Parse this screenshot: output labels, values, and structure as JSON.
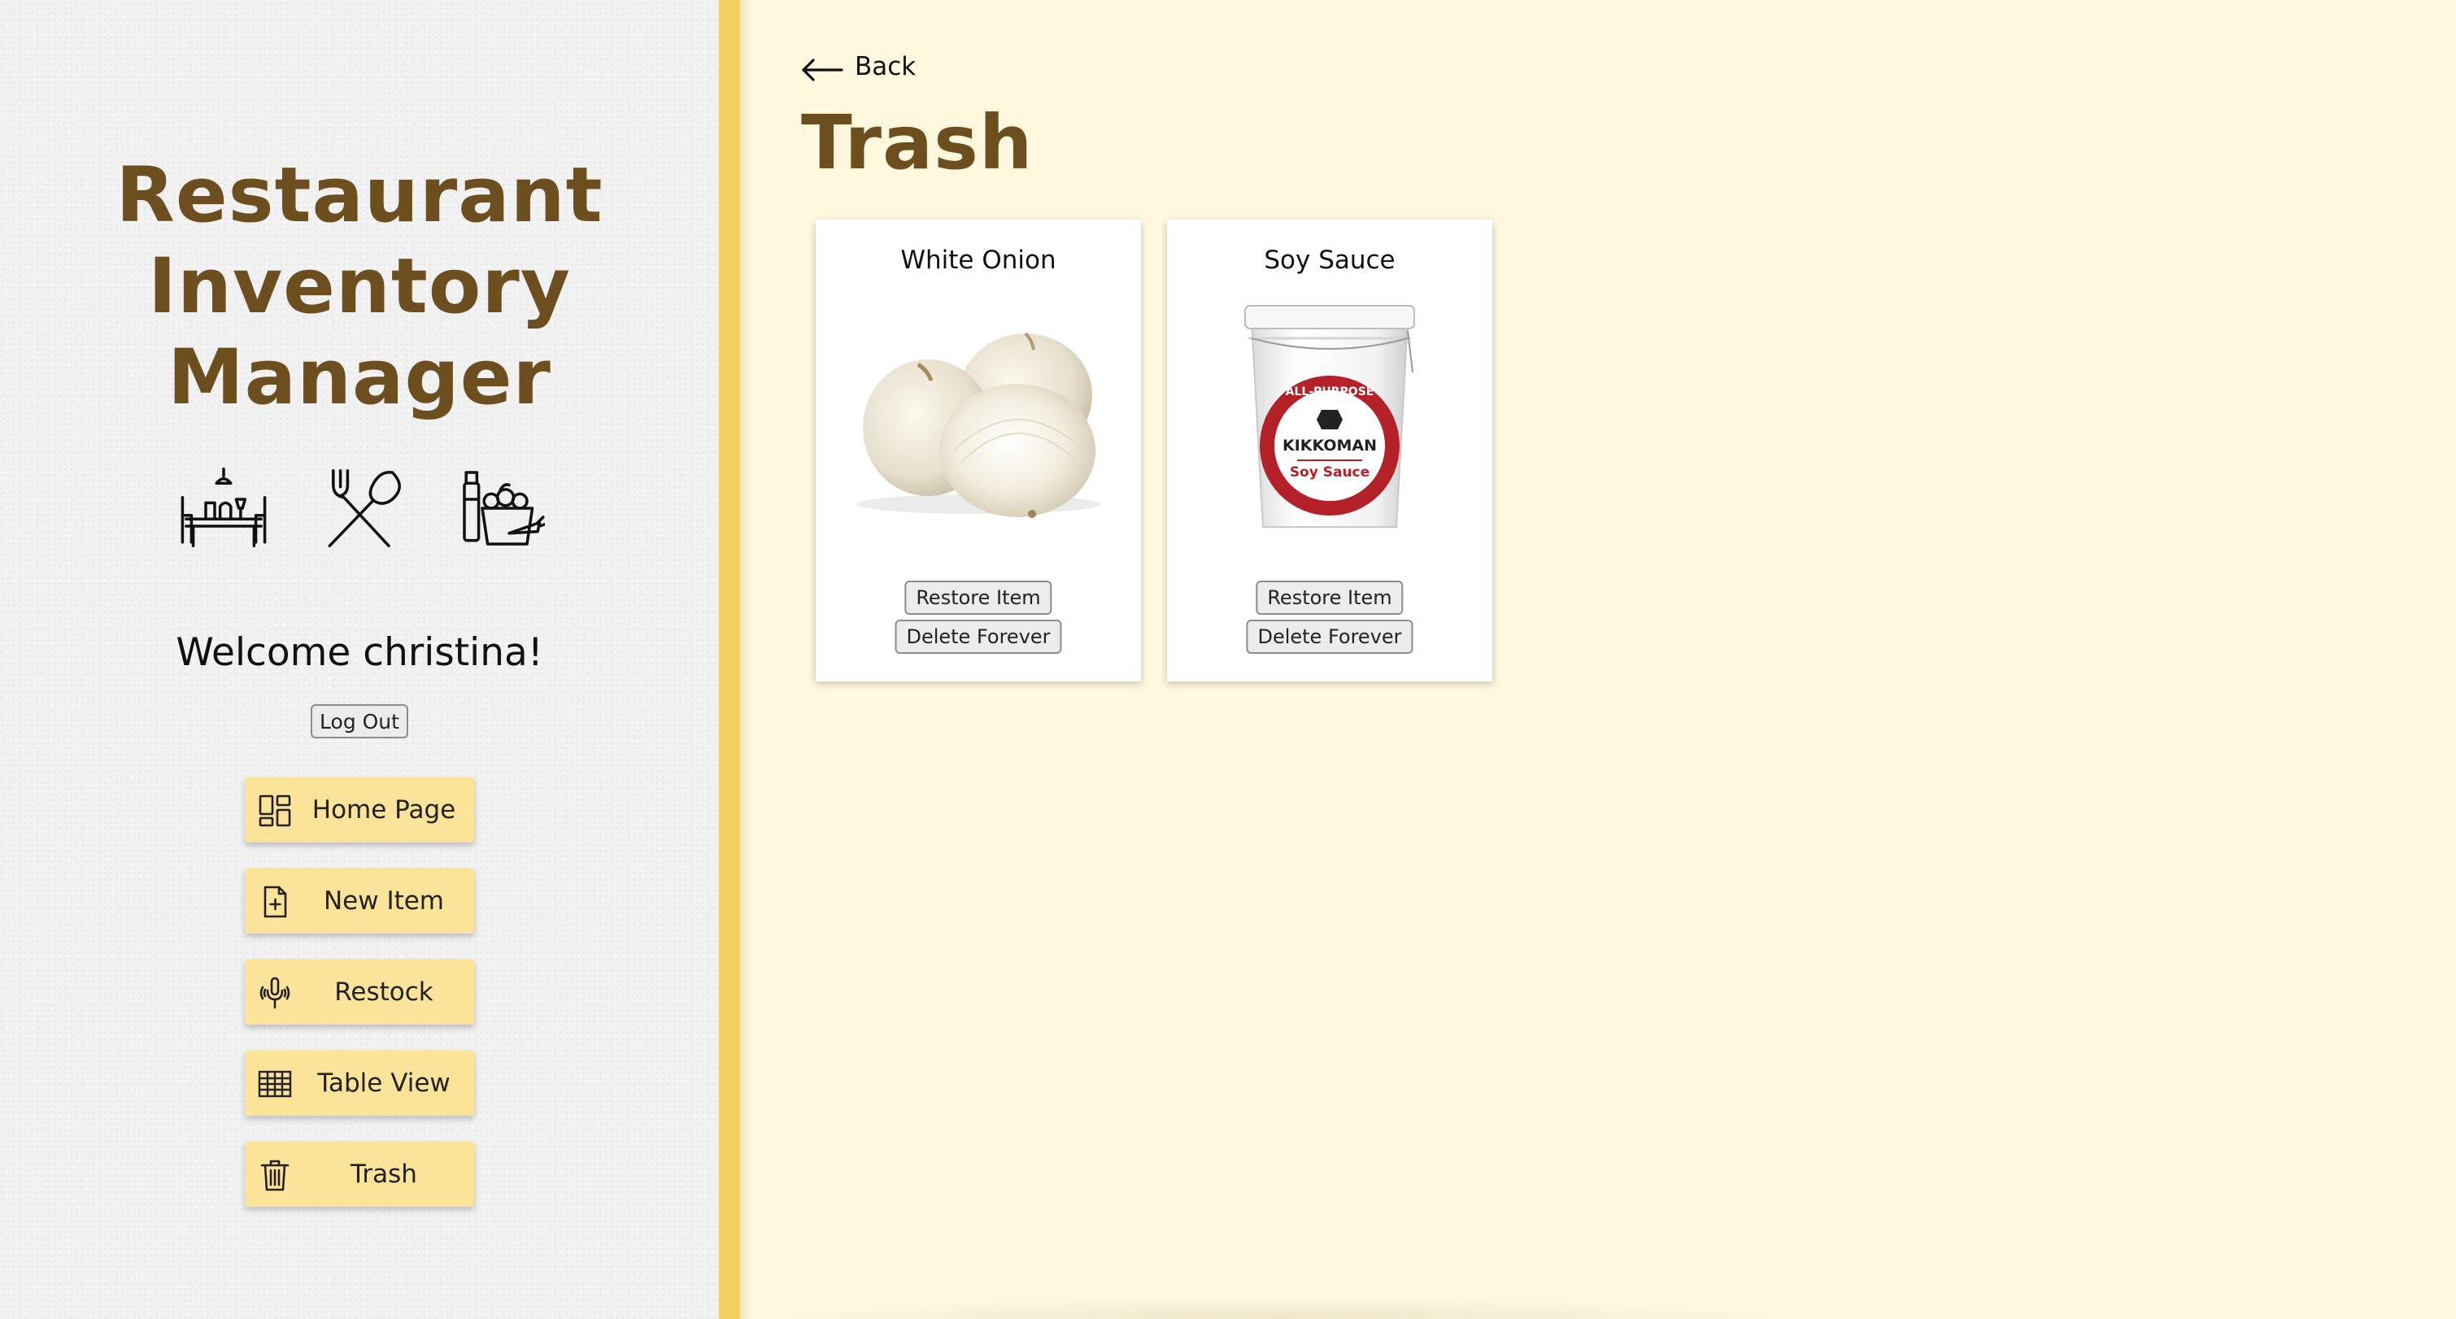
{
  "sidebar": {
    "app_title_lines": [
      "Restaurant",
      "Inventory",
      "Manager"
    ],
    "hero_icons": [
      "restaurant-table-icon",
      "fork-spoon-icon",
      "groceries-icon"
    ],
    "welcome_text": "Welcome christina!",
    "logout_label": "Log Out",
    "nav_items": [
      {
        "label": "Home Page",
        "icon": "dashboard-grid-icon"
      },
      {
        "label": "New Item",
        "icon": "file-add-icon"
      },
      {
        "label": "Restock",
        "icon": "microphone-icon"
      },
      {
        "label": "Table View",
        "icon": "table-grid-icon"
      },
      {
        "label": "Trash",
        "icon": "trash-can-icon"
      }
    ]
  },
  "main": {
    "back_label": "Back",
    "page_title": "Trash",
    "items": [
      {
        "name": "White Onion",
        "restore_label": "Restore Item",
        "delete_label": "Delete Forever"
      },
      {
        "name": "Soy Sauce",
        "restore_label": "Restore Item",
        "delete_label": "Delete Forever"
      }
    ],
    "soy_sauce_label": {
      "brand": "KIKKOMAN",
      "product": "Soy Sauce",
      "ring_text": "ALL-PURPOSE"
    }
  },
  "colors": {
    "title_brown": "#6d4e1f",
    "nav_yellow": "#fbe39a",
    "divider_yellow": "#f4cf63",
    "main_bg": "#fff8df",
    "kikkoman_red": "#b42128"
  }
}
